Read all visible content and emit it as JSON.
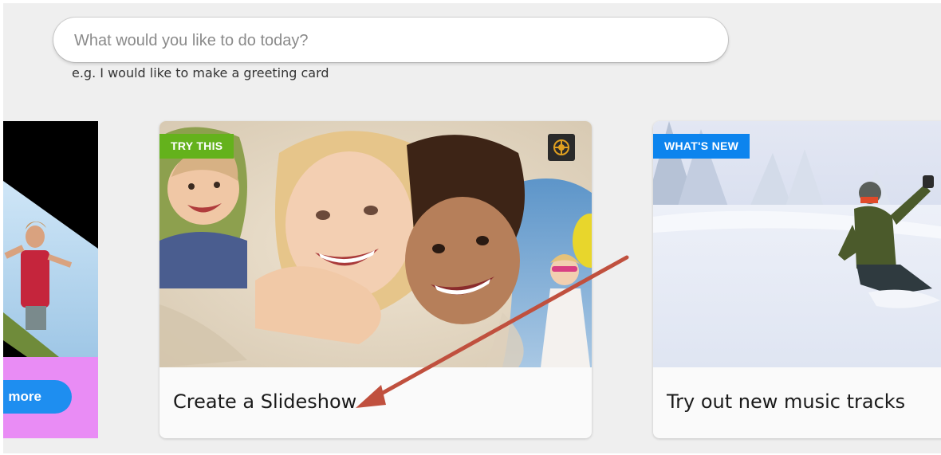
{
  "search": {
    "placeholder": "What would you like to do today?",
    "hint": "e.g. I would like to make a greeting card"
  },
  "cards": [
    {
      "position": "left-partial",
      "button_label": "more",
      "background": "#e98cf5",
      "button_color": "#1e8ef0"
    },
    {
      "badge": "TRY THIS",
      "badge_color": "#64b21c",
      "caption": "Create a Slideshow",
      "icon": "gift-icon"
    },
    {
      "badge": "WHAT'S NEW",
      "badge_color": "#0c84ee",
      "caption": "Try out new music tracks"
    }
  ],
  "annotation": {
    "type": "arrow",
    "color": "#c0503e"
  }
}
